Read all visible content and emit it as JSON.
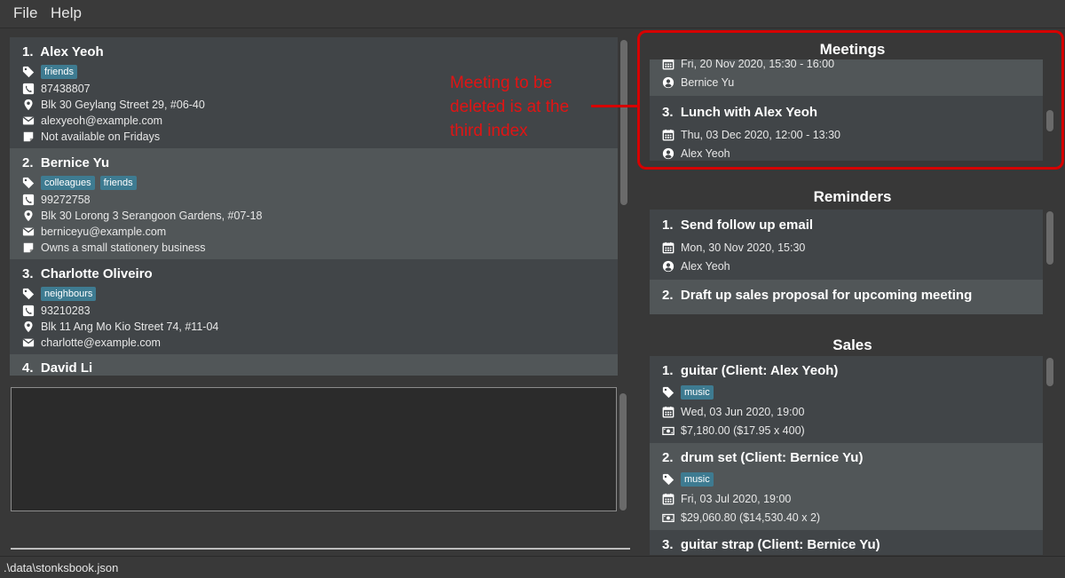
{
  "menu": {
    "file": "File",
    "help": "Help"
  },
  "persons": [
    {
      "index": "1.",
      "name": "Alex Yeoh",
      "tags": [
        "friends"
      ],
      "phone": "87438807",
      "address": "Blk 30 Geylang Street 29, #06-40",
      "email": "alexyeoh@example.com",
      "remark": "Not available on Fridays"
    },
    {
      "index": "2.",
      "name": "Bernice Yu",
      "tags": [
        "colleagues",
        "friends"
      ],
      "phone": "99272758",
      "address": "Blk 30 Lorong 3 Serangoon Gardens, #07-18",
      "email": "berniceyu@example.com",
      "remark": "Owns a small stationery business"
    },
    {
      "index": "3.",
      "name": "Charlotte Oliveiro",
      "tags": [
        "neighbours"
      ],
      "phone": "93210283",
      "address": "Blk 11 Ang Mo Kio Street 74, #11-04",
      "email": "charlotte@example.com"
    },
    {
      "index": "4.",
      "name": "David Li"
    }
  ],
  "meetings": {
    "title": "Meetings",
    "items": [
      {
        "datetime": "Fri, 20 Nov 2020, 15:30 - 16:00",
        "contact": "Bernice Yu"
      },
      {
        "index": "3.",
        "title": "Lunch with Alex Yeoh",
        "datetime": "Thu, 03 Dec 2020, 12:00 - 13:30",
        "contact": "Alex Yeoh"
      }
    ]
  },
  "reminders": {
    "title": "Reminders",
    "items": [
      {
        "index": "1.",
        "title": "Send follow up email",
        "datetime": "Mon, 30 Nov 2020, 15:30",
        "contact": "Alex Yeoh"
      },
      {
        "index": "2.",
        "title": "Draft up sales proposal for upcoming meeting"
      }
    ]
  },
  "sales": {
    "title": "Sales",
    "items": [
      {
        "index": "1.",
        "title": "guitar (Client: Alex Yeoh)",
        "tag": "music",
        "datetime": "Wed, 03 Jun 2020, 19:00",
        "amount": "$7,180.00 ($17.95 x 400)"
      },
      {
        "index": "2.",
        "title": "drum set (Client: Bernice Yu)",
        "tag": "music",
        "datetime": "Fri, 03 Jul 2020, 19:00",
        "amount": "$29,060.80 ($14,530.40 x 2)"
      },
      {
        "index": "3.",
        "title": "guitar strap (Client: Bernice Yu)"
      }
    ]
  },
  "annotation": {
    "text": "Meeting to be deleted is at the third index"
  },
  "status": {
    "path": ".\\data\\stonksbook.json"
  },
  "colors": {
    "accent_red": "#d60000",
    "tag_blue": "#3e7b91",
    "card_dark": "#414548",
    "card_light": "#515658"
  }
}
